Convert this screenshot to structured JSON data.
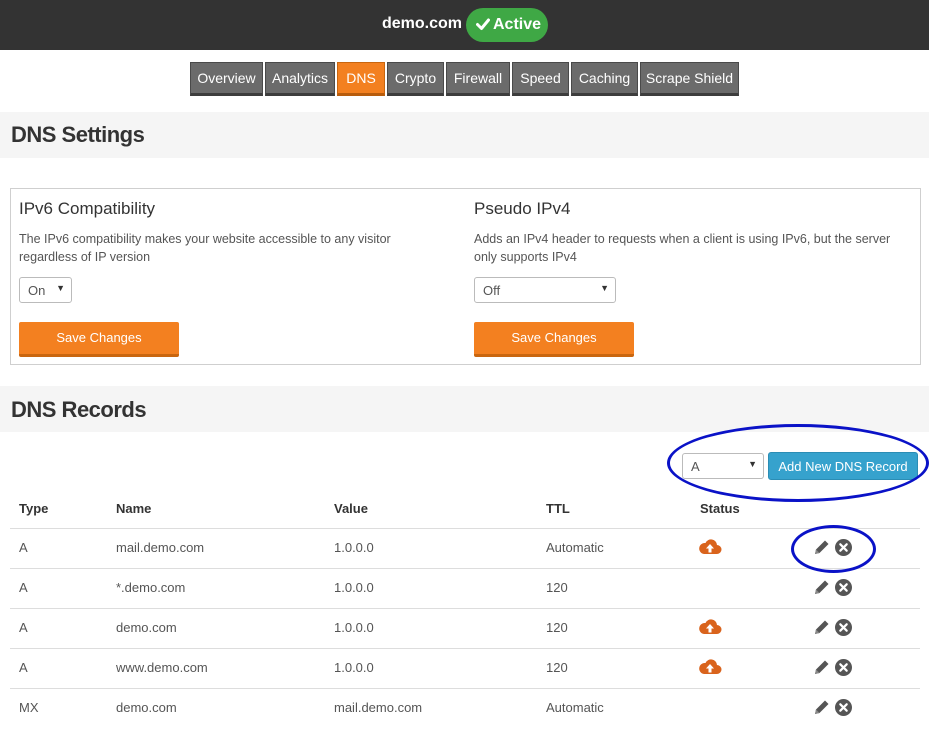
{
  "header": {
    "domain": "demo.com",
    "status": "Active"
  },
  "tabs": [
    "Overview",
    "Analytics",
    "DNS",
    "Crypto",
    "Firewall",
    "Speed",
    "Caching",
    "Scrape Shield"
  ],
  "dns_settings": {
    "title": "DNS Settings",
    "ipv6": {
      "title": "IPv6 Compatibility",
      "description": "The IPv6 compatibility makes your website accessible to any visitor regardless of IP version",
      "value": "On",
      "save_label": "Save Changes"
    },
    "pseudo": {
      "title": "Pseudo IPv4",
      "description": "Adds an IPv4 header to requests when a client is using IPv6, but the server only supports IPv4",
      "value": "Off",
      "save_label": "Save Changes"
    }
  },
  "dns_records": {
    "title": "DNS Records",
    "record_type": "A",
    "add_label": "Add New DNS Record",
    "columns": [
      "Type",
      "Name",
      "Value",
      "TTL",
      "Status"
    ],
    "rows": [
      {
        "type": "A",
        "name": "mail.demo.com",
        "value": "1.0.0.0",
        "ttl": "Automatic",
        "proxied": true
      },
      {
        "type": "A",
        "name": "*.demo.com",
        "value": "1.0.0.0",
        "ttl": "120",
        "proxied": false
      },
      {
        "type": "A",
        "name": "demo.com",
        "value": "1.0.0.0",
        "ttl": "120",
        "proxied": true
      },
      {
        "type": "A",
        "name": "www.demo.com",
        "value": "1.0.0.0",
        "ttl": "120",
        "proxied": true
      },
      {
        "type": "MX",
        "name": "demo.com",
        "value": "mail.demo.com",
        "ttl": "Automatic",
        "proxied": false
      }
    ]
  },
  "colors": {
    "accent": "#f38020",
    "active": "#3fa845",
    "add_button": "#36a2cd",
    "annotation": "#0a12c7",
    "cloud": "#d9631c"
  },
  "icons": [
    "check-icon",
    "cloud-upload-icon",
    "pencil-icon",
    "delete-icon",
    "chevron-down-icon"
  ]
}
